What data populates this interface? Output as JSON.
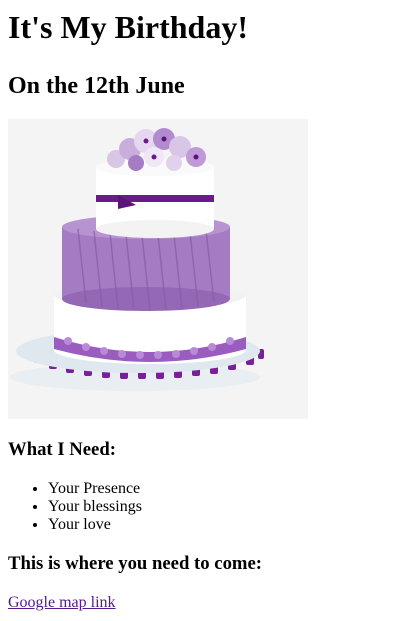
{
  "page": {
    "title": "It's My Birthday!",
    "date_heading": "On the 12th June",
    "needs_heading": "What I Need:",
    "needs": [
      "Your Presence",
      "Your blessings",
      "Your love"
    ],
    "location_heading": "This is where you need to come:",
    "map_link_text": "Google map link"
  },
  "colors": {
    "link_visited": "#551a8b",
    "cake_purple": "#a57bc3",
    "ribbon_purple": "#6a1b8a"
  }
}
